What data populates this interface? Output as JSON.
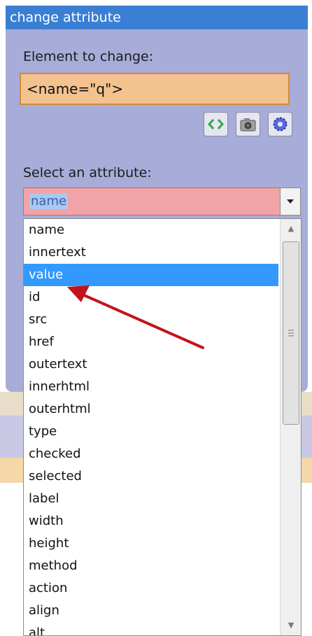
{
  "panel": {
    "title": "change attribute",
    "element_label": "Element to change:",
    "element_value": "<name=\"q\">",
    "toolbar": {
      "icons": [
        "code-brackets-icon",
        "camera-icon",
        "gear-icon"
      ]
    },
    "attribute_label": "Select an attribute:",
    "attribute_selected": "name",
    "options": [
      "name",
      "innertext",
      "value",
      "id",
      "src",
      "href",
      "outertext",
      "innerhtml",
      "outerhtml",
      "type",
      "checked",
      "selected",
      "label",
      "width",
      "height",
      "method",
      "action",
      "align",
      "alt"
    ],
    "highlighted_option": "value"
  },
  "colors": {
    "title_bar": "#3b7fd4",
    "panel_bg": "#a8acd8",
    "element_box": "#f3c28f",
    "select_box": "#f0a4a7",
    "highlight": "#3399ff",
    "annotation_arrow": "#c2141a"
  }
}
